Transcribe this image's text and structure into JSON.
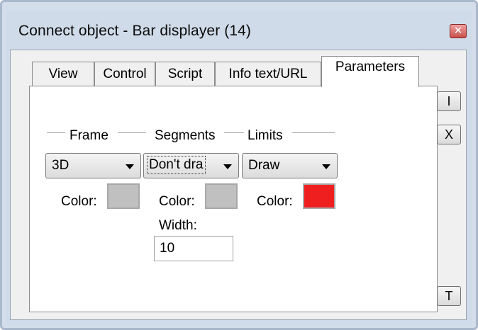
{
  "window": {
    "title": "Connect object - Bar displayer (14)",
    "close_glyph": "✕"
  },
  "tabs": [
    {
      "label": "View",
      "active": false
    },
    {
      "label": "Control",
      "active": false
    },
    {
      "label": "Script",
      "active": false
    },
    {
      "label": "Info text/URL",
      "active": false
    },
    {
      "label": "Parameters",
      "active": true
    }
  ],
  "parameters": {
    "frame": {
      "group_label": "Frame",
      "mode": "3D",
      "color_label": "Color:",
      "color": "#c0c0c0"
    },
    "segments": {
      "group_label": "Segments",
      "mode": "Don't dra",
      "color_label": "Color:",
      "color": "#c0c0c0",
      "width_label": "Width:",
      "width_value": "10"
    },
    "limits": {
      "group_label": "Limits",
      "mode": "Draw",
      "color_label": "Color:",
      "color": "#f01f1f"
    }
  },
  "side_buttons": {
    "insert_label": "I",
    "delete_label": "X",
    "text_label": "T"
  },
  "colors": {
    "window_border": "#aab8cc",
    "close_button": "#c8504a"
  }
}
